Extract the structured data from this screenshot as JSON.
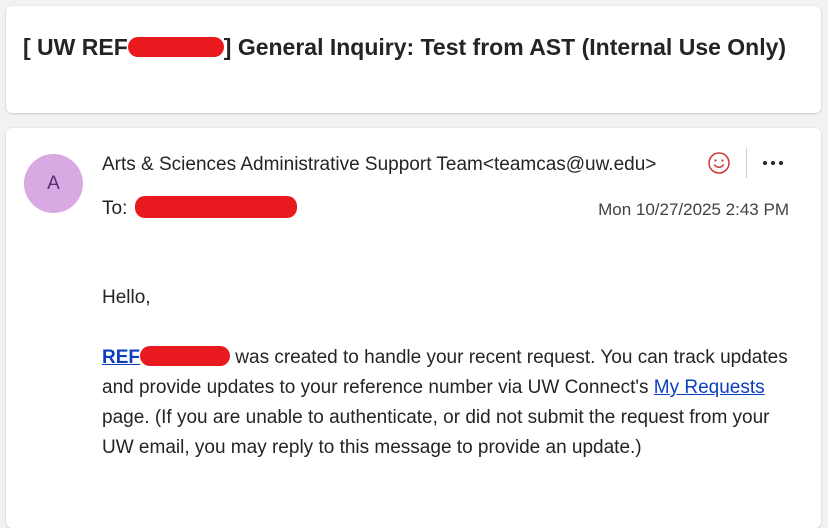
{
  "email": {
    "subject_prefix": "[ UW REF",
    "subject_suffix": "] General Inquiry: Test from AST (Internal Use Only)",
    "sender": {
      "avatar_initial": "A",
      "avatar_color": "#d9a9e4",
      "display": "Arts & Sciences Administrative Support Team<teamcas@uw.edu>"
    },
    "to_label": "To:",
    "timestamp": "Mon 10/27/2025 2:43 PM",
    "actions": {
      "react_icon": "smiley-icon",
      "more_icon": "more-horizontal-icon"
    },
    "body": {
      "greeting": "Hello,",
      "ref_link_text": "REF",
      "text_before_link": " was created to handle your recent request. You can track updates and provide updates to your reference number via UW Connect's ",
      "link_text": "My Requests",
      "text_after_link": " page. (If you are unable to authenticate, or did not submit the request from your UW email, you may reply to this message to provide an update.)"
    }
  },
  "colors": {
    "redaction": "#e8191f",
    "link": "#0c3fbf",
    "react_icon": "#d13438"
  }
}
